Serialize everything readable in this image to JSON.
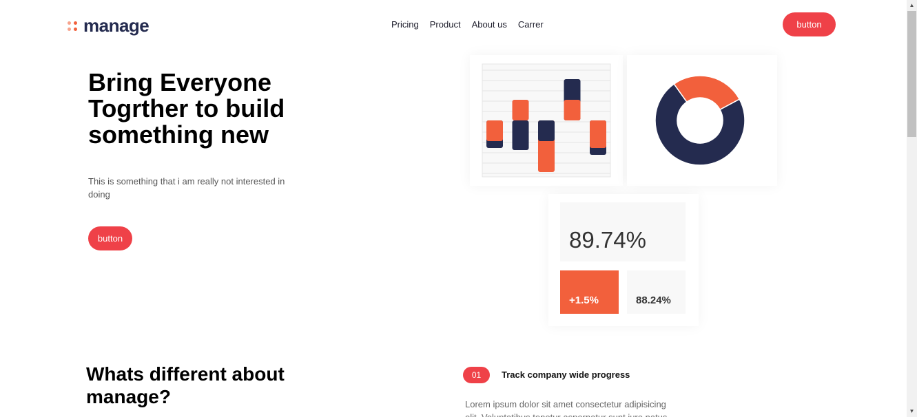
{
  "brand": {
    "name": "manage",
    "accent": "#f2603c",
    "navy": "#242b4f",
    "button_color": "#ef4148"
  },
  "nav": {
    "items": [
      "Pricing",
      "Product",
      "About us",
      "Carrer"
    ]
  },
  "header": {
    "button_label": "button"
  },
  "hero": {
    "title": "Bring Everyone Togrther to build something new",
    "subtitle": "This is something that i am really not interested in doing",
    "button_label": "button"
  },
  "dashboard": {
    "bar_chart": {
      "type": "bar",
      "series_colors": [
        "#f2603c",
        "#242b4f"
      ],
      "bars": [
        {
          "orange": -3,
          "navy": -4
        },
        {
          "orange": 3,
          "navy": -4.3
        },
        {
          "orange": -7.5,
          "navy": -3
        },
        {
          "orange": 3,
          "navy": 6
        },
        {
          "orange": -4,
          "navy": -5
        }
      ]
    },
    "donut": {
      "type": "pie",
      "slices": [
        {
          "value": 27,
          "color": "#f2603c"
        },
        {
          "value": 73,
          "color": "#242b4f"
        }
      ]
    },
    "stat_main": "89.74%",
    "stat_change": "+1.5%",
    "stat_secondary": "88.24%"
  },
  "section": {
    "title": "Whats different about manage?",
    "step": {
      "number": "01",
      "title": "Track company wide progress",
      "text": "Lorem ipsum dolor sit amet consectetur adipisicing elit. Voluptatibus tenetur aspernatur sunt iure natus"
    }
  }
}
